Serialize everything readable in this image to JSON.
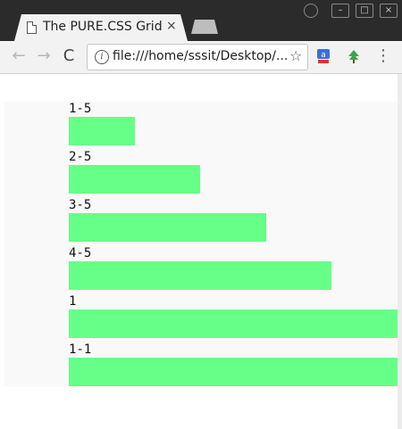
{
  "browser": {
    "tab_title": "The PURE.CSS Grid",
    "tab_close": "×",
    "url": "file:///home/sssit/Desktop/...",
    "star_icon": "star-icon",
    "menu_icon": "kebab-menu-icon"
  },
  "grid": {
    "rows": [
      {
        "label": "1-5",
        "fraction": 0.2
      },
      {
        "label": "2-5",
        "fraction": 0.4
      },
      {
        "label": "3-5",
        "fraction": 0.6
      },
      {
        "label": "4-5",
        "fraction": 0.8
      },
      {
        "label": "1",
        "fraction": 1.0
      },
      {
        "label": "1-1",
        "fraction": 1.0
      }
    ],
    "bar_color": "#66ff88",
    "background_color": "#f9f9f9"
  }
}
